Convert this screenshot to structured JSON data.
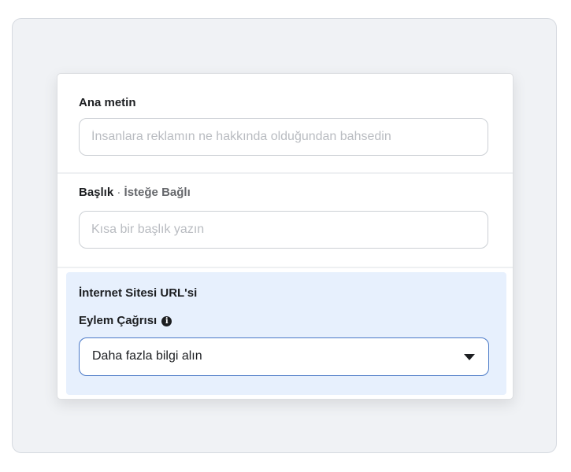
{
  "primary_text": {
    "label": "Ana metin",
    "placeholder": "İnsanlara reklamın ne hakkında olduğundan bahsedin",
    "value": ""
  },
  "headline": {
    "label": "Başlık",
    "separator": " · ",
    "optional_label": "İsteğe Bağlı",
    "placeholder": "Kısa bir başlık yazın",
    "value": ""
  },
  "website_section": {
    "url_label": "İnternet Sitesi URL'si",
    "cta_label": "Eylem Çağrısı",
    "info_icon": "info-icon",
    "cta_selected": "Daha fazla bilgi alın",
    "dropdown_icon": "caret-down-icon"
  },
  "colors": {
    "highlight_bg": "#e7f0fd",
    "select_border": "#4a79c7",
    "outer_bg": "#f0f2f5"
  }
}
